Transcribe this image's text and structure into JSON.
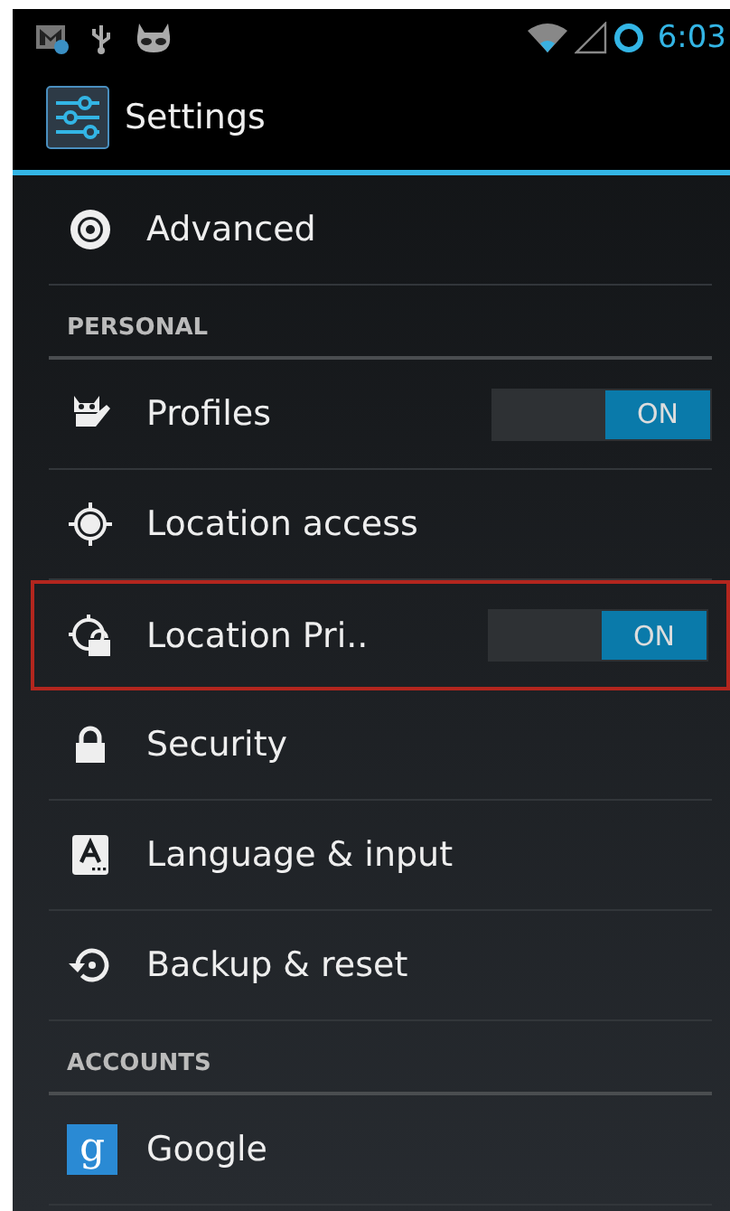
{
  "status_bar": {
    "time": "6:03"
  },
  "action_bar": {
    "title": "Settings"
  },
  "list": [
    {
      "kind": "item",
      "label": "Advanced",
      "highlighted": false
    },
    {
      "kind": "header",
      "label": "PERSONAL"
    },
    {
      "kind": "toggle",
      "label": "Profiles",
      "on": true,
      "switch_text": "ON",
      "highlighted": false
    },
    {
      "kind": "item",
      "label": "Location access",
      "highlighted": false
    },
    {
      "kind": "toggle",
      "label": "Location Pri..",
      "on": true,
      "switch_text": "ON",
      "highlighted": true
    },
    {
      "kind": "item",
      "label": "Security",
      "highlighted": false
    },
    {
      "kind": "item",
      "label": "Language & input",
      "highlighted": false
    },
    {
      "kind": "item",
      "label": "Backup & reset",
      "highlighted": false
    },
    {
      "kind": "header",
      "label": "ACCOUNTS"
    },
    {
      "kind": "item",
      "icon_text": "g",
      "label": "Google",
      "highlighted": false
    }
  ]
}
